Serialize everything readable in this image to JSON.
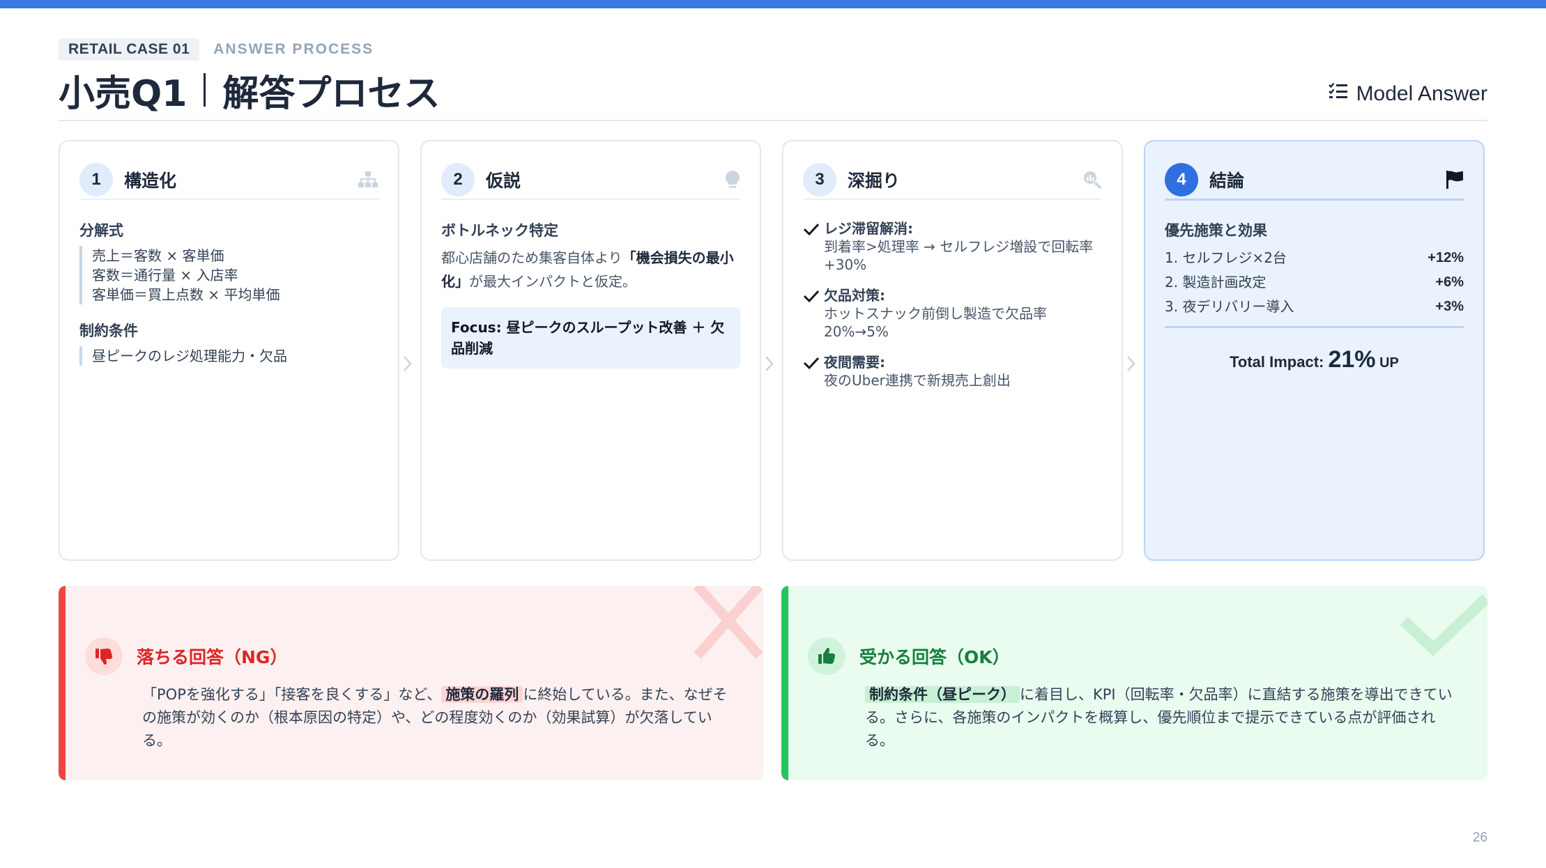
{
  "header": {
    "case_tag": "RETAIL CASE 01",
    "process_tag": "ANSWER PROCESS",
    "title_main": "小売Q1",
    "title_sub": "解答プロセス",
    "model_answer": "Model Answer"
  },
  "steps": [
    {
      "num": "1",
      "title": "構造化",
      "icon": "org-chart-icon",
      "formula_heading": "分解式",
      "formula": [
        "売上＝客数 × 客単価",
        "客数＝通行量 × 入店率",
        "客単価＝買上点数 × 平均単価"
      ],
      "constraint_heading": "制約条件",
      "constraint": "昼ピークのレジ処理能力・欠品"
    },
    {
      "num": "2",
      "title": "仮説",
      "icon": "lightbulb-icon",
      "heading": "ボトルネック特定",
      "text_pre": "都心店舗のため集客自体より",
      "text_bold": "「機会損失の最小化」",
      "text_post": "が最大インパクトと仮定。",
      "focus": "Focus: 昼ピークのスループット改善 ＋ 欠品削減"
    },
    {
      "num": "3",
      "title": "深掘り",
      "icon": "magnifier-chart-icon",
      "checks": [
        {
          "heading": "レジ滞留解消:",
          "text": "到着率>処理率 → セルフレジ増設で回転率+30%"
        },
        {
          "heading": "欠品対策:",
          "text": "ホットスナック前倒し製造で欠品率20%→5%"
        },
        {
          "heading": "夜間需要:",
          "text": "夜のUber連携で新規売上創出"
        }
      ]
    },
    {
      "num": "4",
      "title": "結論",
      "icon": "flag-icon",
      "heading": "優先施策と効果",
      "items": [
        {
          "label": "1. セルフレジ×2台",
          "value": "+12%"
        },
        {
          "label": "2. 製造計画改定",
          "value": "+6%"
        },
        {
          "label": "3. 夜デリバリー導入",
          "value": "+3%"
        }
      ],
      "impact_label": "Total Impact: ",
      "impact_value": "21%",
      "impact_unit": " UP"
    }
  ],
  "ng": {
    "title": "落ちる回答（NG）",
    "text_pre": "「POPを強化する」「接客を良くする」など、",
    "highlight": "施策の羅列",
    "text_post": "に終始している。また、なぜその施策が効くのか（根本原因の特定）や、どの程度効くのか（効果試算）が欠落している。",
    "icon": "thumbs-down-icon"
  },
  "ok": {
    "title": "受かる回答（OK）",
    "highlight": "制約条件（昼ピーク）",
    "text_post": "に着目し、KPI（回転率・欠品率）に直結する施策を導出できている。さらに、各施策のインパクトを概算し、優先順位まで提示できている点が評価される。",
    "icon": "thumbs-up-icon"
  },
  "page_number": "26",
  "colors": {
    "accent": "#3a77e0",
    "ng_accent": "#ef4444",
    "ok_accent": "#22c55e"
  }
}
